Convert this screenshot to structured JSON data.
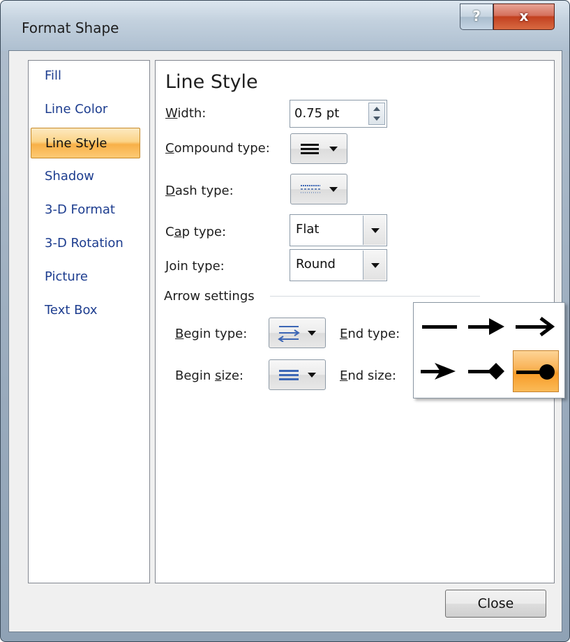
{
  "window": {
    "title": "Format Shape",
    "help_label": "?",
    "close_label": "x"
  },
  "nav": {
    "items": [
      {
        "label": "Fill"
      },
      {
        "label": "Line Color"
      },
      {
        "label": "Line Style",
        "selected": true
      },
      {
        "label": "Shadow"
      },
      {
        "label": "3-D Format"
      },
      {
        "label": "3-D Rotation"
      },
      {
        "label": "Picture"
      },
      {
        "label": "Text Box"
      }
    ]
  },
  "panel": {
    "heading": "Line Style",
    "width": {
      "label_u": "W",
      "label_rest": "idth:",
      "value": "0.75 pt"
    },
    "compound": {
      "label_u": "C",
      "label_rest": "ompound type:",
      "icon": "compound-lines-icon"
    },
    "dash": {
      "label_u": "D",
      "label_rest": "ash type:",
      "icon": "dash-lines-icon"
    },
    "cap": {
      "label_pre": "C",
      "label_u": "a",
      "label_rest": "p type:",
      "value": "Flat"
    },
    "join": {
      "label_u": "J",
      "label_rest": "oin type:",
      "value": "Round"
    },
    "arrow_settings": {
      "title": "Arrow settings",
      "begin_type": {
        "label_u": "B",
        "label_rest": "egin type:",
        "icon": "arrow-type-icon"
      },
      "end_type": {
        "label_u": "E",
        "label_rest": "nd type:",
        "icon": "arrow-type-icon"
      },
      "begin_size": {
        "label_pre": "Begin ",
        "label_u": "s",
        "label_rest": "ize:",
        "icon": "arrow-size-icon"
      },
      "end_size": {
        "label_u": "E",
        "label_rest": "nd size:"
      }
    }
  },
  "end_type_popup": {
    "options": [
      {
        "name": "no-arrow"
      },
      {
        "name": "arrow"
      },
      {
        "name": "open-arrow"
      },
      {
        "name": "stealth-arrow"
      },
      {
        "name": "diamond-arrow"
      },
      {
        "name": "oval-arrow",
        "selected": true
      }
    ]
  },
  "footer": {
    "close_label": "Close"
  },
  "colors": {
    "accent_selected": "#f8b048",
    "nav_text": "#1d3d8f",
    "icon_blue": "#3c66b5"
  }
}
